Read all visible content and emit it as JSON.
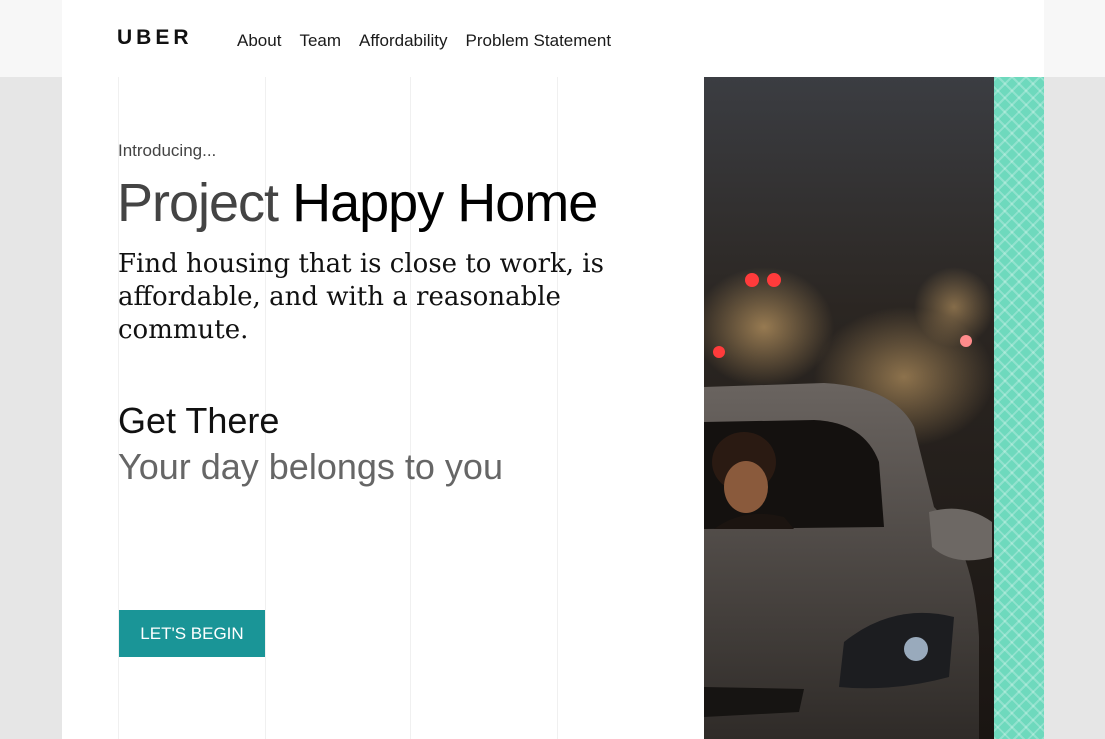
{
  "header": {
    "logo": "UBER",
    "nav": [
      "About",
      "Team",
      "Affordability",
      "Problem Statement"
    ]
  },
  "hero": {
    "intro": "Introducing...",
    "title_light": "Project",
    "title_bold": "Happy Home",
    "tagline": "Find housing that is close to work, is affordable, and with a reasonable commute.",
    "subheading": "Get There",
    "subtext": "Your day belongs to you",
    "cta_label": "LET'S BEGIN"
  },
  "colors": {
    "accent": "#1a9597",
    "pattern": "#6ed9bd",
    "page_bg": "#e6e6e6"
  },
  "image": {
    "alt_icon": "night-city-car-photo"
  }
}
